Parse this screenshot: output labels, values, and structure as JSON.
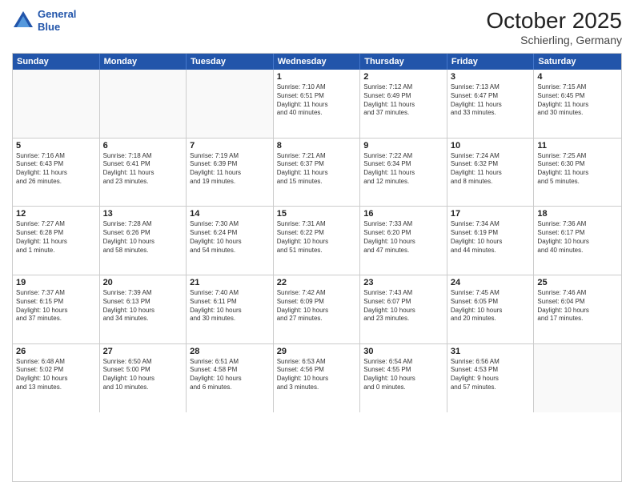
{
  "header": {
    "logo_line1": "General",
    "logo_line2": "Blue",
    "month": "October 2025",
    "location": "Schierling, Germany"
  },
  "weekdays": [
    "Sunday",
    "Monday",
    "Tuesday",
    "Wednesday",
    "Thursday",
    "Friday",
    "Saturday"
  ],
  "weeks": [
    [
      {
        "day": "",
        "info": ""
      },
      {
        "day": "",
        "info": ""
      },
      {
        "day": "",
        "info": ""
      },
      {
        "day": "1",
        "info": "Sunrise: 7:10 AM\nSunset: 6:51 PM\nDaylight: 11 hours\nand 40 minutes."
      },
      {
        "day": "2",
        "info": "Sunrise: 7:12 AM\nSunset: 6:49 PM\nDaylight: 11 hours\nand 37 minutes."
      },
      {
        "day": "3",
        "info": "Sunrise: 7:13 AM\nSunset: 6:47 PM\nDaylight: 11 hours\nand 33 minutes."
      },
      {
        "day": "4",
        "info": "Sunrise: 7:15 AM\nSunset: 6:45 PM\nDaylight: 11 hours\nand 30 minutes."
      }
    ],
    [
      {
        "day": "5",
        "info": "Sunrise: 7:16 AM\nSunset: 6:43 PM\nDaylight: 11 hours\nand 26 minutes."
      },
      {
        "day": "6",
        "info": "Sunrise: 7:18 AM\nSunset: 6:41 PM\nDaylight: 11 hours\nand 23 minutes."
      },
      {
        "day": "7",
        "info": "Sunrise: 7:19 AM\nSunset: 6:39 PM\nDaylight: 11 hours\nand 19 minutes."
      },
      {
        "day": "8",
        "info": "Sunrise: 7:21 AM\nSunset: 6:37 PM\nDaylight: 11 hours\nand 15 minutes."
      },
      {
        "day": "9",
        "info": "Sunrise: 7:22 AM\nSunset: 6:34 PM\nDaylight: 11 hours\nand 12 minutes."
      },
      {
        "day": "10",
        "info": "Sunrise: 7:24 AM\nSunset: 6:32 PM\nDaylight: 11 hours\nand 8 minutes."
      },
      {
        "day": "11",
        "info": "Sunrise: 7:25 AM\nSunset: 6:30 PM\nDaylight: 11 hours\nand 5 minutes."
      }
    ],
    [
      {
        "day": "12",
        "info": "Sunrise: 7:27 AM\nSunset: 6:28 PM\nDaylight: 11 hours\nand 1 minute."
      },
      {
        "day": "13",
        "info": "Sunrise: 7:28 AM\nSunset: 6:26 PM\nDaylight: 10 hours\nand 58 minutes."
      },
      {
        "day": "14",
        "info": "Sunrise: 7:30 AM\nSunset: 6:24 PM\nDaylight: 10 hours\nand 54 minutes."
      },
      {
        "day": "15",
        "info": "Sunrise: 7:31 AM\nSunset: 6:22 PM\nDaylight: 10 hours\nand 51 minutes."
      },
      {
        "day": "16",
        "info": "Sunrise: 7:33 AM\nSunset: 6:20 PM\nDaylight: 10 hours\nand 47 minutes."
      },
      {
        "day": "17",
        "info": "Sunrise: 7:34 AM\nSunset: 6:19 PM\nDaylight: 10 hours\nand 44 minutes."
      },
      {
        "day": "18",
        "info": "Sunrise: 7:36 AM\nSunset: 6:17 PM\nDaylight: 10 hours\nand 40 minutes."
      }
    ],
    [
      {
        "day": "19",
        "info": "Sunrise: 7:37 AM\nSunset: 6:15 PM\nDaylight: 10 hours\nand 37 minutes."
      },
      {
        "day": "20",
        "info": "Sunrise: 7:39 AM\nSunset: 6:13 PM\nDaylight: 10 hours\nand 34 minutes."
      },
      {
        "day": "21",
        "info": "Sunrise: 7:40 AM\nSunset: 6:11 PM\nDaylight: 10 hours\nand 30 minutes."
      },
      {
        "day": "22",
        "info": "Sunrise: 7:42 AM\nSunset: 6:09 PM\nDaylight: 10 hours\nand 27 minutes."
      },
      {
        "day": "23",
        "info": "Sunrise: 7:43 AM\nSunset: 6:07 PM\nDaylight: 10 hours\nand 23 minutes."
      },
      {
        "day": "24",
        "info": "Sunrise: 7:45 AM\nSunset: 6:05 PM\nDaylight: 10 hours\nand 20 minutes."
      },
      {
        "day": "25",
        "info": "Sunrise: 7:46 AM\nSunset: 6:04 PM\nDaylight: 10 hours\nand 17 minutes."
      }
    ],
    [
      {
        "day": "26",
        "info": "Sunrise: 6:48 AM\nSunset: 5:02 PM\nDaylight: 10 hours\nand 13 minutes."
      },
      {
        "day": "27",
        "info": "Sunrise: 6:50 AM\nSunset: 5:00 PM\nDaylight: 10 hours\nand 10 minutes."
      },
      {
        "day": "28",
        "info": "Sunrise: 6:51 AM\nSunset: 4:58 PM\nDaylight: 10 hours\nand 6 minutes."
      },
      {
        "day": "29",
        "info": "Sunrise: 6:53 AM\nSunset: 4:56 PM\nDaylight: 10 hours\nand 3 minutes."
      },
      {
        "day": "30",
        "info": "Sunrise: 6:54 AM\nSunset: 4:55 PM\nDaylight: 10 hours\nand 0 minutes."
      },
      {
        "day": "31",
        "info": "Sunrise: 6:56 AM\nSunset: 4:53 PM\nDaylight: 9 hours\nand 57 minutes."
      },
      {
        "day": "",
        "info": ""
      }
    ]
  ]
}
